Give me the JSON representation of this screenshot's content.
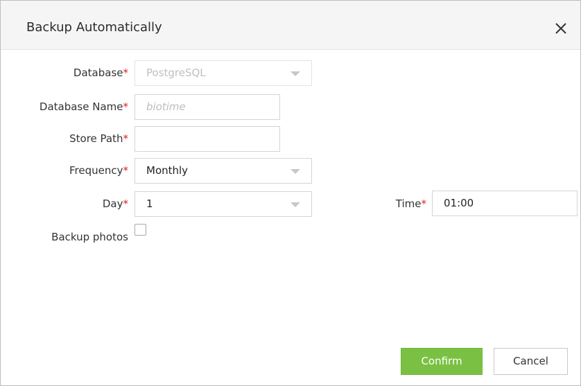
{
  "dialog": {
    "title": "Backup Automatically",
    "close_icon": "close-icon"
  },
  "form": {
    "required_mark": "*",
    "database": {
      "label": "Database",
      "value": "PostgreSQL",
      "disabled": true
    },
    "database_name": {
      "label": "Database Name",
      "placeholder": "biotime"
    },
    "store_path": {
      "label": "Store Path",
      "value": ""
    },
    "frequency": {
      "label": "Frequency",
      "value": "Monthly"
    },
    "day": {
      "label": "Day",
      "value": "1"
    },
    "time": {
      "label": "Time",
      "value": "01:00"
    },
    "backup_photos": {
      "label": "Backup photos",
      "checked": false
    }
  },
  "buttons": {
    "confirm": "Confirm",
    "cancel": "Cancel"
  },
  "colors": {
    "accent": "#7ac143",
    "required": "#e02020",
    "header_bg": "#f5f5f5"
  }
}
